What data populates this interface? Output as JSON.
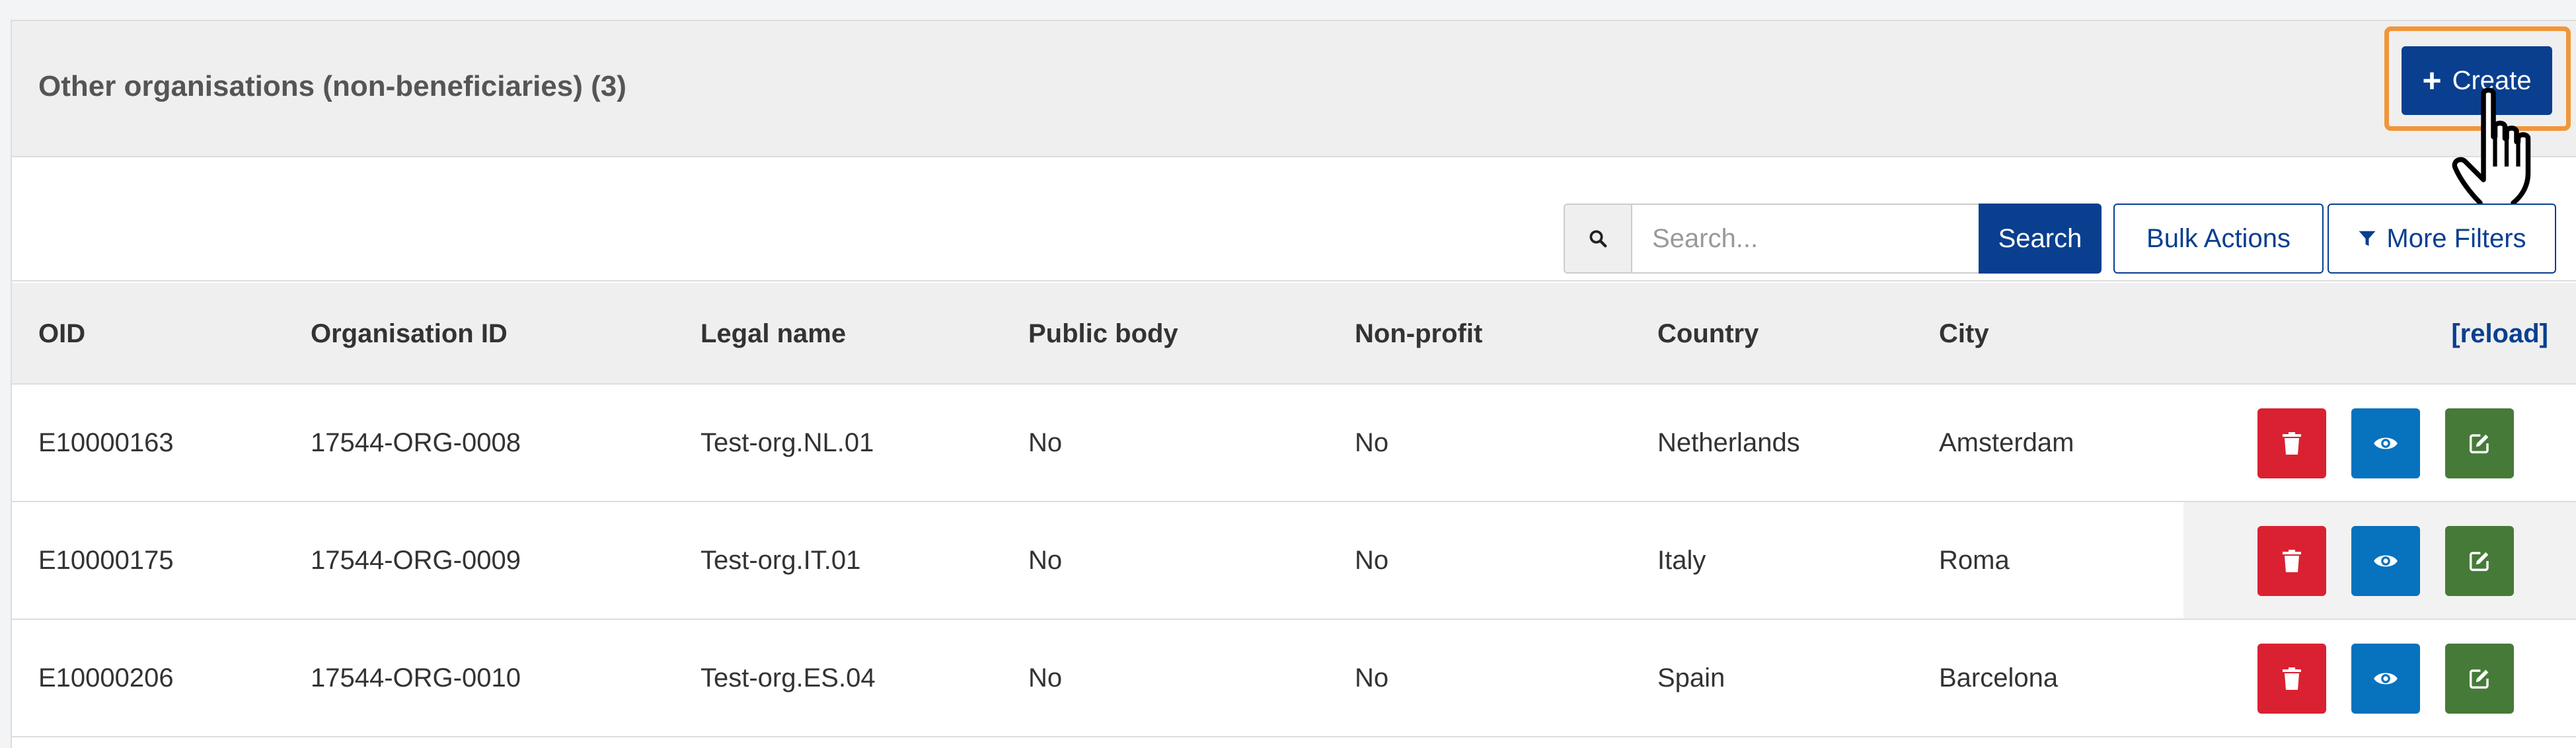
{
  "header": {
    "title": "Other organisations (non-beneficiaries) (3)",
    "create_label": "Create"
  },
  "toolbar": {
    "search_placeholder": "Search...",
    "search_label": "Search",
    "bulk_actions_label": "Bulk Actions",
    "more_filters_label": "More Filters"
  },
  "table": {
    "columns": [
      "OID",
      "Organisation ID",
      "Legal name",
      "Public body",
      "Non-profit",
      "Country",
      "City"
    ],
    "reload_label": "[reload]",
    "rows": [
      {
        "oid": "E10000163",
        "org_id": "17544-ORG-0008",
        "legal_name": "Test-org.NL.01",
        "public_body": "No",
        "non_profit": "No",
        "country": "Netherlands",
        "city": "Amsterdam"
      },
      {
        "oid": "E10000175",
        "org_id": "17544-ORG-0009",
        "legal_name": "Test-org.IT.01",
        "public_body": "No",
        "non_profit": "No",
        "country": "Italy",
        "city": "Roma"
      },
      {
        "oid": "E10000206",
        "org_id": "17544-ORG-0010",
        "legal_name": "Test-org.ES.04",
        "public_body": "No",
        "non_profit": "No",
        "country": "Spain",
        "city": "Barcelona"
      }
    ],
    "row_actions": [
      "trash-icon",
      "eye-icon",
      "edit-icon"
    ]
  },
  "colors": {
    "primary": "#0a3f8f",
    "delete": "#da2131",
    "view": "#0772be",
    "edit": "#467a39",
    "highlight": "#f0963a"
  },
  "icons": {
    "create": "plus-icon",
    "search": "search-icon",
    "filters": "filter-icon",
    "cursor": "hand-pointer-icon"
  }
}
